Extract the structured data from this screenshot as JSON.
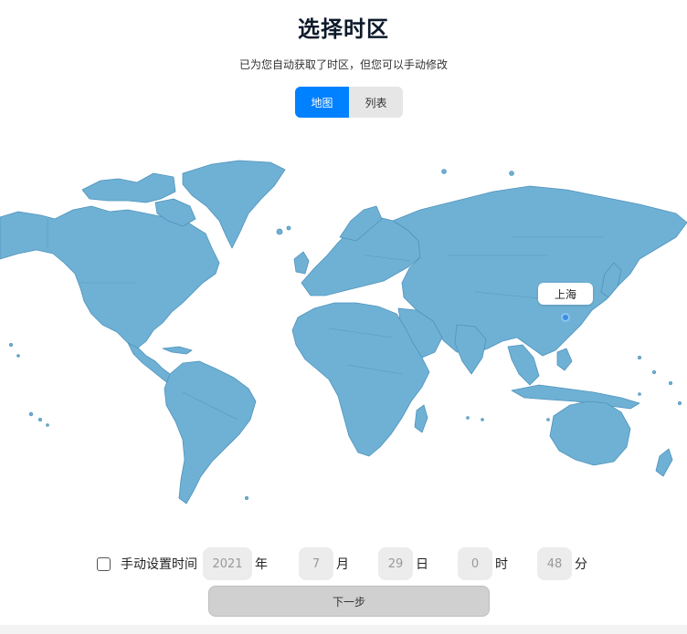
{
  "header": {
    "title": "选择时区",
    "subtitle": "已为您自动获取了时区，但您可以手动修改"
  },
  "view_toggle": {
    "map_label": "地图",
    "list_label": "列表",
    "selected": "地图"
  },
  "map": {
    "selected_city": "上海",
    "land_color": "#6fb1d4",
    "border_color": "#4f93bd",
    "pin_color": "#3b8fe0"
  },
  "time": {
    "manual_label": "手动设置时间",
    "manual_checked": false,
    "year": "2021",
    "year_unit": "年",
    "month": "7",
    "month_unit": "月",
    "day": "29",
    "day_unit": "日",
    "hour": "0",
    "hour_unit": "时",
    "minute": "48",
    "minute_unit": "分"
  },
  "footer": {
    "next_label": "下一步"
  },
  "colors": {
    "accent": "#0081ff",
    "button_disabled": "#d0d0d0"
  }
}
